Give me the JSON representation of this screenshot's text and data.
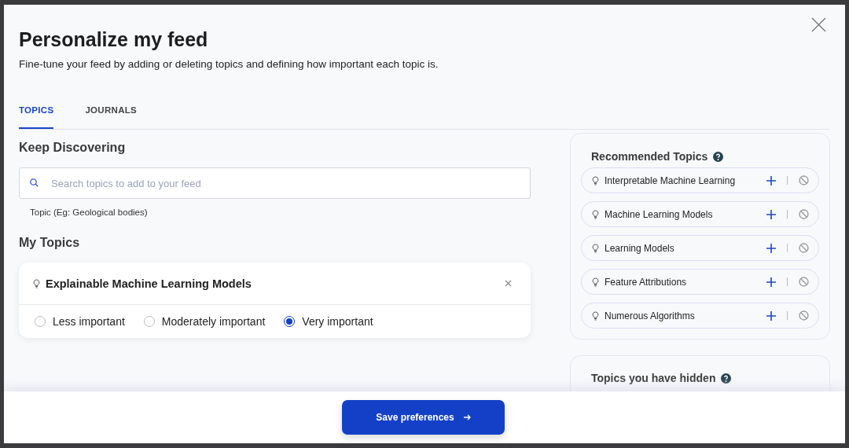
{
  "dialog": {
    "title": "Personalize my feed",
    "subtitle": "Fine-tune your feed by adding or deleting topics and defining how important each topic is."
  },
  "tabs": [
    {
      "label": "TOPICS",
      "selected": true
    },
    {
      "label": "JOURNALS",
      "selected": false
    }
  ],
  "discover": {
    "heading": "Keep Discovering",
    "search": {
      "placeholder": "Search topics to add to your feed"
    },
    "hint": "Topic (Eg: Geological bodies)"
  },
  "my_topics": {
    "heading": "My Topics",
    "topics": [
      {
        "name": "Explainable Machine Learning Models",
        "importance": [
          {
            "label": "Less important",
            "selected": false
          },
          {
            "label": "Moderately important",
            "selected": false
          },
          {
            "label": "Very important",
            "selected": true
          }
        ]
      }
    ]
  },
  "recommended": {
    "heading": "Recommended Topics",
    "items": [
      {
        "name": "Interpretable Machine Learning"
      },
      {
        "name": "Machine Learning Models"
      },
      {
        "name": "Learning Models"
      },
      {
        "name": "Feature Attributions"
      },
      {
        "name": "Numerous Algorithms"
      }
    ]
  },
  "hidden": {
    "heading": "Topics you have hidden"
  },
  "footer": {
    "button": "Save preferences"
  }
}
